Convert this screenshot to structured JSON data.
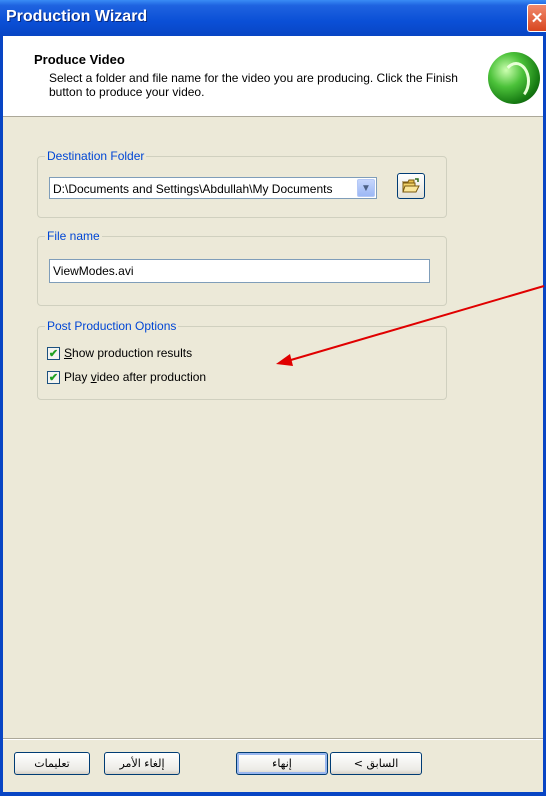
{
  "window": {
    "title": "Production Wizard",
    "close_icon": "close-icon"
  },
  "header": {
    "title": "Produce Video",
    "description": "Select a folder and file name for the video you are producing.  Click the Finish button to produce your video."
  },
  "destination": {
    "legend": "Destination Folder",
    "path": "D:\\Documents and Settings\\Abdullah\\My Documents"
  },
  "filename": {
    "legend": "File name",
    "value": "ViewModes.avi"
  },
  "post": {
    "legend": "Post Production Options",
    "options": [
      {
        "label_pre": "",
        "accel": "S",
        "label_post": "how production results",
        "checked": true
      },
      {
        "label_pre": "Play ",
        "accel": "v",
        "label_post": "ideo after production",
        "checked": true
      }
    ]
  },
  "buttons": {
    "help": "تعليمات",
    "cancel": "إلغاء الأمر",
    "finish": "إنهاء",
    "back": "< السابق"
  },
  "colors": {
    "titlebar": "#0a4fd6",
    "legend": "#0046d5",
    "arrow": "#e00000"
  }
}
